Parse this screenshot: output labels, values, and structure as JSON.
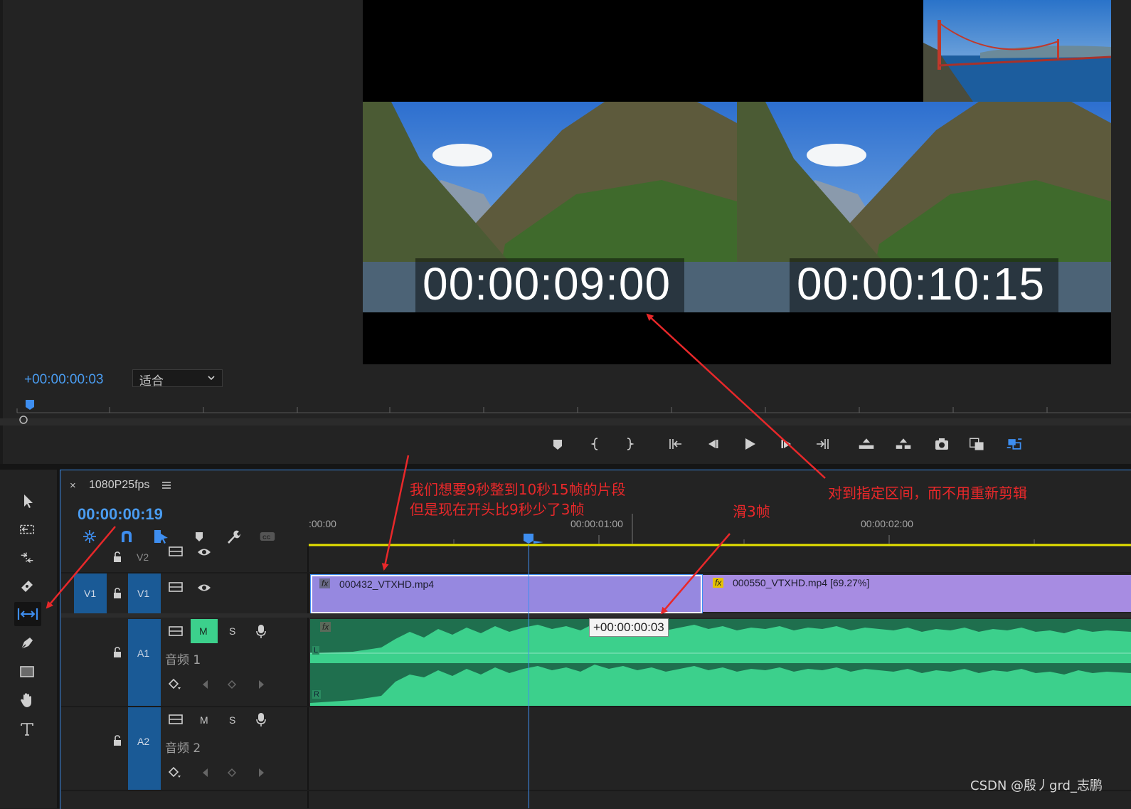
{
  "monitor": {
    "timecode_left": "00:00:09:00",
    "timecode_right": "00:00:10:15",
    "offset": "+00:00:00:03",
    "zoom_select": "适合"
  },
  "controls": [
    "marker-icon",
    "mark-in-icon",
    "mark-out-icon",
    "go-to-in-icon",
    "step-back-icon",
    "play-icon",
    "step-forward-icon",
    "go-to-out-icon",
    "lift-icon",
    "extract-icon",
    "camera-icon",
    "compare-icon",
    "multicam-icon"
  ],
  "timeline": {
    "tab_label": "1080P25fps",
    "playhead": "00:00:00:19",
    "ruler": [
      ":00:00",
      "00:00:01:00",
      "00:00:02:00"
    ],
    "tracks": {
      "v2": {
        "label": "V2"
      },
      "v1": {
        "label": "V1",
        "source": "V1"
      },
      "a1": {
        "label": "A1",
        "name": "音频 1",
        "mute": "M",
        "solo": "S"
      },
      "a2": {
        "label": "A2",
        "name": "音频 2",
        "mute": "M",
        "solo": "S"
      }
    },
    "clips": [
      {
        "name": "000432_VTXHD.mp4",
        "fx": "fx"
      },
      {
        "name": "000550_VTXHD.mp4 [69.27%]",
        "fx": "fx"
      }
    ],
    "audio_fx": "fx",
    "channel_l": "L",
    "channel_r": "R",
    "slip_tooltip": "+00:00:00:03"
  },
  "annotations": {
    "note1_line1": "我们想要9秒整到10秒15帧的片段",
    "note1_line2": "但是现在开头比9秒少了3帧",
    "note2": "滑3帧",
    "note3": "对到指定区间，而不用重新剪辑"
  },
  "watermark": "CSDN @殷丿grd_志鹏"
}
